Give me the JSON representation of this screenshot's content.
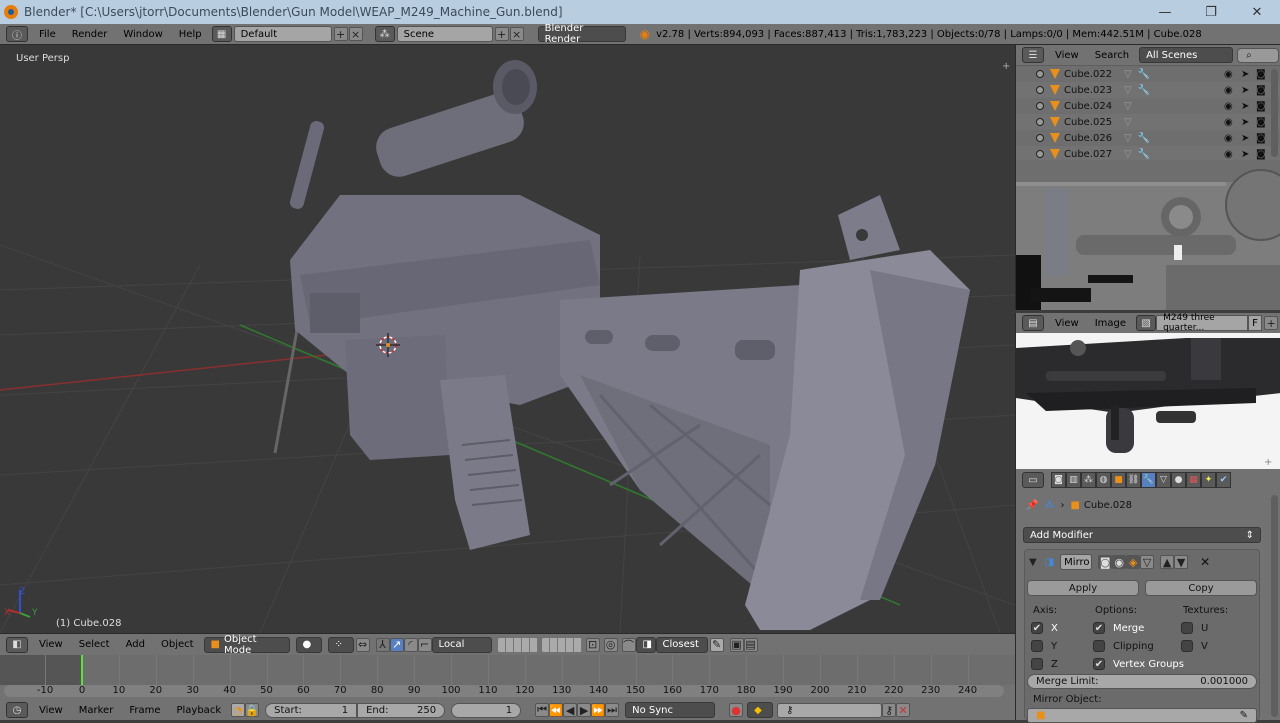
{
  "window": {
    "title": "Blender* [C:\\Users\\jtorr\\Documents\\Blender\\Gun Model\\WEAP_M249_Machine_Gun.blend]",
    "controls": {
      "minimize": "—",
      "maximize": "❐",
      "close": "✕"
    }
  },
  "infobar": {
    "menus": [
      "File",
      "Render",
      "Window",
      "Help"
    ],
    "layout": "Default",
    "scene": "Scene",
    "engine": "Blender Render",
    "stats": "v2.78 | Verts:894,093 | Faces:887,413 | Tris:1,783,223 | Objects:0/78 | Lamps:0/0 | Mem:442.51M | Cube.028"
  },
  "viewport": {
    "view_label": "User Persp",
    "object_label": "(1) Cube.028",
    "axis": {
      "x": "X",
      "y": "Y",
      "z": "Z"
    },
    "colors": {
      "x_axis": "#b03030",
      "y_axis": "#3aa03a",
      "z_axis": "#3050d0"
    }
  },
  "viewport_header": {
    "menus": [
      "View",
      "Select",
      "Add",
      "Object"
    ],
    "mode": "Object Mode",
    "pivot_orientation": "Local",
    "snap_target": "Closest"
  },
  "timeline": {
    "ticks": [
      "-10",
      "0",
      "10",
      "20",
      "30",
      "40",
      "50",
      "60",
      "70",
      "80",
      "90",
      "100",
      "110",
      "120",
      "130",
      "140",
      "150",
      "160",
      "170",
      "180",
      "190",
      "200",
      "210",
      "220",
      "230",
      "240"
    ],
    "current_frame": "1",
    "menus": [
      "View",
      "Marker",
      "Frame",
      "Playback"
    ],
    "start_label": "Start:",
    "start": "1",
    "end_label": "End:",
    "end": "250",
    "sync": "No Sync",
    "colors": {
      "playhead": "#5ee03a"
    }
  },
  "outliner": {
    "menus": [
      "View",
      "Search"
    ],
    "filter": "All Scenes",
    "items": [
      {
        "name": "Cube.022",
        "has_modifier": true
      },
      {
        "name": "Cube.023",
        "has_modifier": true
      },
      {
        "name": "Cube.024",
        "has_modifier": false
      },
      {
        "name": "Cube.025",
        "has_modifier": false
      },
      {
        "name": "Cube.026",
        "has_modifier": true
      },
      {
        "name": "Cube.027",
        "has_modifier": true
      }
    ]
  },
  "image_editor": {
    "menus": [
      "View",
      "Image"
    ],
    "image_name": "M249 three quarter...",
    "fake_user": "F"
  },
  "properties": {
    "object_name": "Cube.028",
    "add_modifier": "Add Modifier",
    "modifier": {
      "name": "Mirro",
      "apply": "Apply",
      "copy": "Copy",
      "axis_label": "Axis:",
      "options_label": "Options:",
      "textures_label": "Textures:",
      "axis": [
        {
          "label": "X",
          "checked": true
        },
        {
          "label": "Y",
          "checked": false
        },
        {
          "label": "Z",
          "checked": false
        }
      ],
      "options": [
        {
          "label": "Merge",
          "checked": true
        },
        {
          "label": "Clipping",
          "checked": false
        },
        {
          "label": "Vertex Groups",
          "checked": true
        }
      ],
      "textures": [
        {
          "label": "U",
          "checked": false
        },
        {
          "label": "V",
          "checked": false
        }
      ],
      "merge_limit_label": "Merge Limit:",
      "merge_limit": "0.001000",
      "mirror_object_label": "Mirror Object:"
    }
  }
}
